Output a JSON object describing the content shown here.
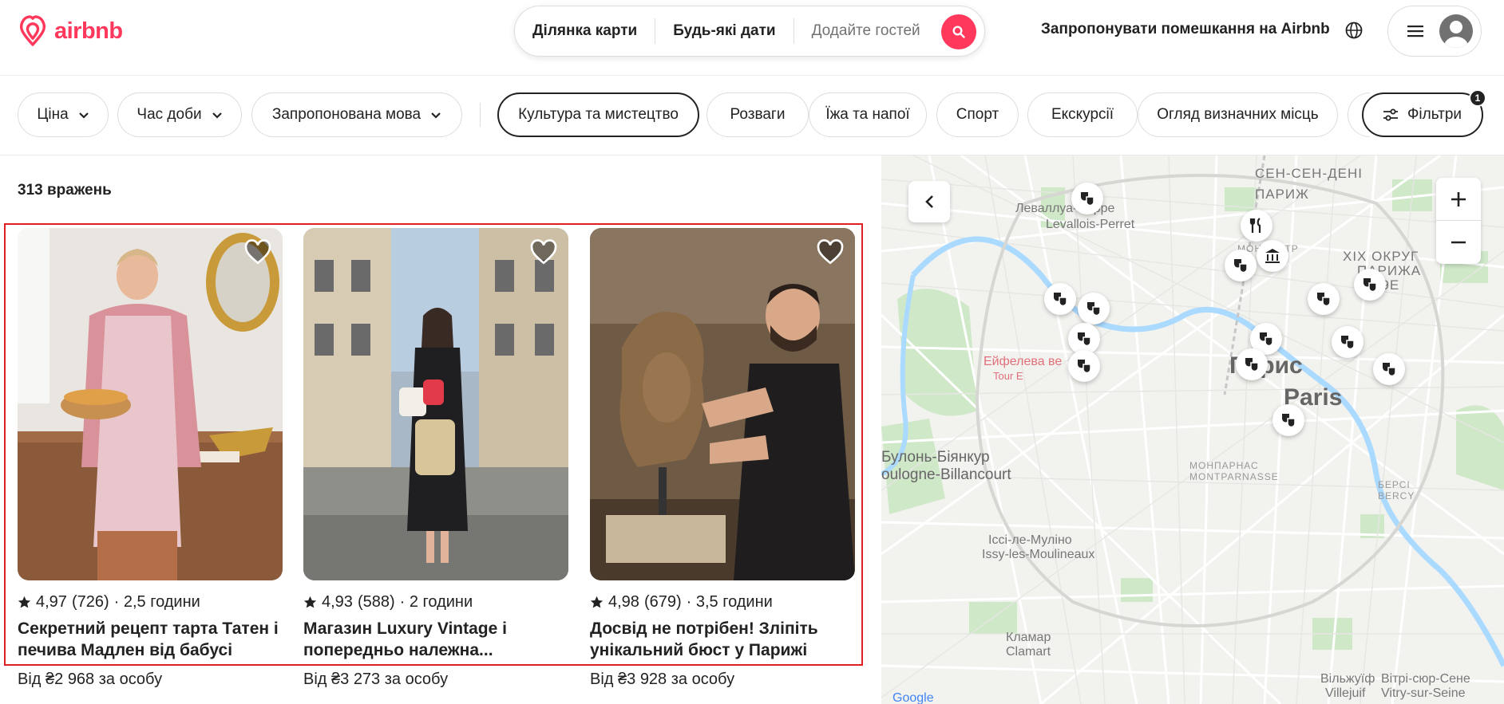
{
  "header": {
    "logo_text": "airbnb",
    "search": {
      "location": "Ділянка карти",
      "dates": "Будь-які дати",
      "guests_placeholder": "Додайте гостей"
    },
    "host_link": "Запропонувати помешкання на Airbnb",
    "colors": {
      "brand": "#ff385c"
    }
  },
  "filters": {
    "dropdowns": [
      "Ціна",
      "Час доби",
      "Запропонована мова"
    ],
    "categories": [
      {
        "label": "Культура та мистецтво",
        "active": true
      },
      {
        "label": "Розваги",
        "active": false
      },
      {
        "label": "Їжа та напої",
        "active": false
      },
      {
        "label": "Спорт",
        "active": false
      },
      {
        "label": "Екскурсії",
        "active": false
      },
      {
        "label": "Огляд визначних місць",
        "active": false
      }
    ],
    "filters_button": "Фільтри",
    "filters_badge": "1"
  },
  "results": {
    "count_label": "313 вражень",
    "cards": [
      {
        "rating": "4,97",
        "reviews": "(726)",
        "duration": "· 2,5  години",
        "title": "Секретний рецепт тарта Татен і печива Мадлен від бабусі",
        "price": "Від ₴2 968 за особу"
      },
      {
        "rating": "4,93",
        "reviews": "(588)",
        "duration": "· 2  години",
        "title": "Магазин Luxury Vintage і попередньо належна...",
        "price": "Від ₴3 273 за особу"
      },
      {
        "rating": "4,98",
        "reviews": "(679)",
        "duration": "· 3,5  години",
        "title": "Досвід не потрібен! Зліпіть унікальний бюст у Парижі",
        "price": "Від ₴3 928 за особу"
      }
    ]
  },
  "map": {
    "labels": {
      "levallois": "Леваллуа-Перре",
      "levallois_fr": "Levallois-Perret",
      "saint_denis": "СЕН-СЕН-ДЕНІ",
      "paris_top": "ПАРИЖ",
      "montmartre": "МОНМАРТР",
      "xix": "XIX ОКРУГ",
      "xix2": "ПАРИЖА",
      "xix3": "19E",
      "eiffel": "Ейфелева ве",
      "eiffel2": "Tour E",
      "paris_uk": "Парис",
      "paris": "Paris",
      "boulogne": "Булонь-Біянкур",
      "boulogne_fr": "oulogne-Billancourt",
      "montparnasse": "МОНПАРНАС",
      "montparnasse_fr": "MONTPARNASSE",
      "bercy": "БЕРСІ",
      "bercy_fr": "BERCY",
      "issy": "Іссі-ле-Муліно",
      "issy_fr": "Issy-les-Moulineaux",
      "clamart": "Кламар",
      "clamart_fr": "Clamart",
      "villejuif": "Вільжуїф",
      "villejuif_fr": "Villejuif",
      "vitry": "Вітрі-сюр-Сене",
      "vitry_fr": "Vitry-sur-Seine",
      "google": "Google"
    }
  }
}
